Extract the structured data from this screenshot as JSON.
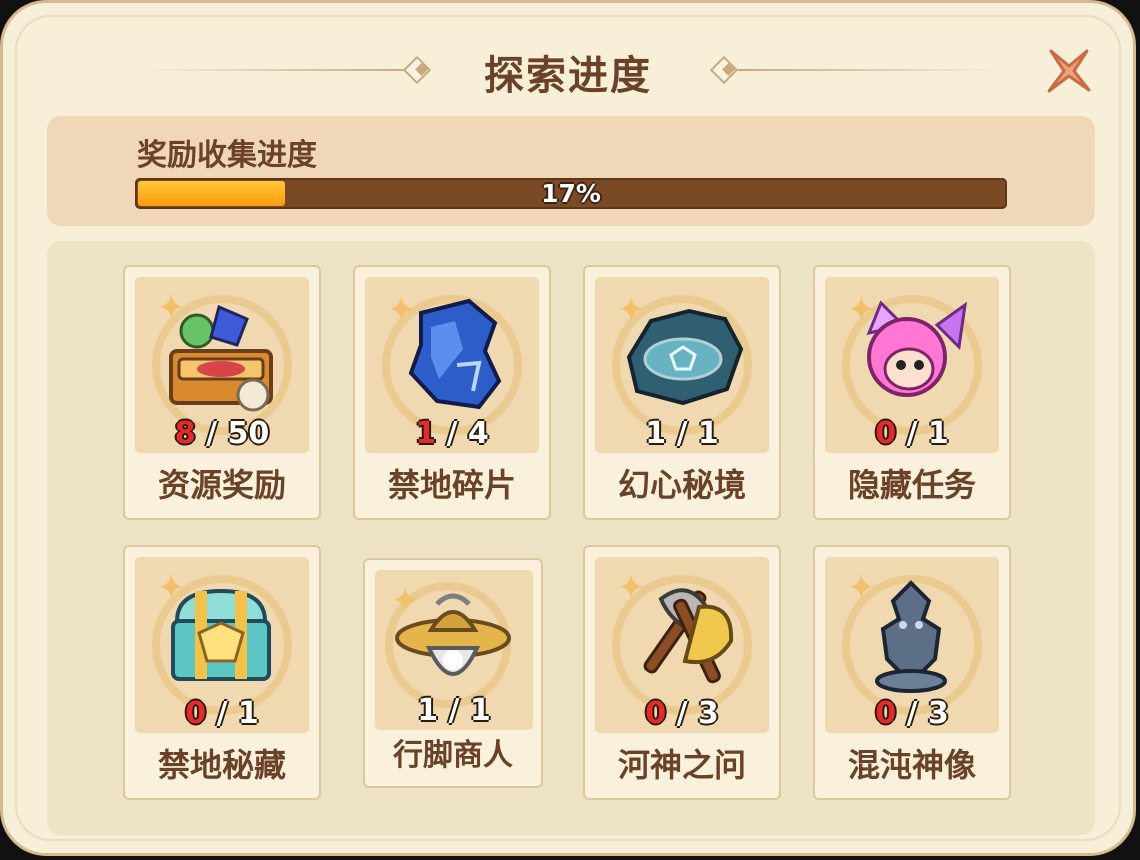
{
  "title": "探索进度",
  "progress": {
    "label": "奖励收集进度",
    "percent_text": "17%",
    "fraction": 0.17
  },
  "items": [
    {
      "name": "资源奖励",
      "current": "8",
      "total": "50",
      "icon": "resource-chest-icon",
      "current_color": "#e62a2a"
    },
    {
      "name": "禁地碎片",
      "current": "1",
      "total": "4",
      "icon": "forbidden-fragment-icon",
      "current_color": "#e62a2a"
    },
    {
      "name": "幻心秘境",
      "current": "1",
      "total": "1",
      "icon": "magic-stone-icon",
      "current_color": "#ffffff"
    },
    {
      "name": "隐藏任务",
      "current": "0",
      "total": "1",
      "icon": "hidden-girl-icon",
      "current_color": "#e62a2a"
    },
    {
      "name": "禁地秘藏",
      "current": "0",
      "total": "1",
      "icon": "treasure-chest-icon",
      "current_color": "#e62a2a"
    },
    {
      "name": "行脚商人",
      "current": "1",
      "total": "1",
      "icon": "merchant-icon",
      "current_color": "#ffffff"
    },
    {
      "name": "河神之问",
      "current": "0",
      "total": "3",
      "icon": "axes-icon",
      "current_color": "#e62a2a"
    },
    {
      "name": "混沌神像",
      "current": "0",
      "total": "3",
      "icon": "chaos-statue-icon",
      "current_color": "#e62a2a"
    }
  ]
}
